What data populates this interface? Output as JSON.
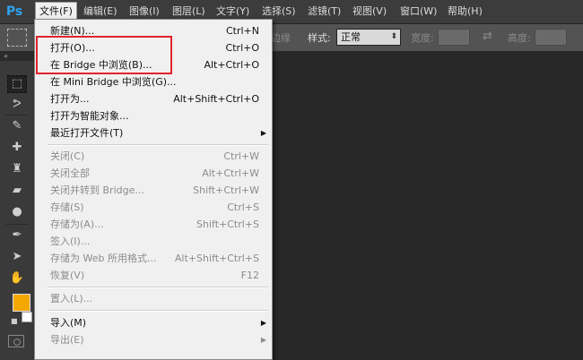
{
  "app": {
    "logo": "Ps"
  },
  "menubar": {
    "items": [
      {
        "label": "文件(F)"
      },
      {
        "label": "编辑(E)"
      },
      {
        "label": "图像(I)"
      },
      {
        "label": "图层(L)"
      },
      {
        "label": "文字(Y)"
      },
      {
        "label": "选择(S)"
      },
      {
        "label": "滤镜(T)"
      },
      {
        "label": "视图(V)"
      },
      {
        "label": "窗口(W)"
      },
      {
        "label": "帮助(H)"
      }
    ]
  },
  "options_bar": {
    "partial_label": "调整边缘...",
    "style_label": "样式:",
    "style_value": "正常",
    "width_label": "宽度:",
    "height_label": "高度:"
  },
  "file_menu": {
    "items": [
      {
        "label": "新建(N)...",
        "shortcut": "Ctrl+N",
        "enabled": true
      },
      {
        "label": "打开(O)...",
        "shortcut": "Ctrl+O",
        "enabled": true
      },
      {
        "label": "在 Bridge 中浏览(B)...",
        "shortcut": "Alt+Ctrl+O",
        "enabled": true
      },
      {
        "label": "在 Mini Bridge 中浏览(G)...",
        "shortcut": "",
        "enabled": true
      },
      {
        "label": "打开为...",
        "shortcut": "Alt+Shift+Ctrl+O",
        "enabled": true
      },
      {
        "label": "打开为智能对象...",
        "shortcut": "",
        "enabled": true
      },
      {
        "label": "最近打开文件(T)",
        "shortcut": "",
        "enabled": true,
        "submenu": true
      },
      {
        "label": "关闭(C)",
        "shortcut": "Ctrl+W",
        "enabled": false
      },
      {
        "label": "关闭全部",
        "shortcut": "Alt+Ctrl+W",
        "enabled": false
      },
      {
        "label": "关闭并转到 Bridge...",
        "shortcut": "Shift+Ctrl+W",
        "enabled": false
      },
      {
        "label": "存储(S)",
        "shortcut": "Ctrl+S",
        "enabled": false
      },
      {
        "label": "存储为(A)...",
        "shortcut": "Shift+Ctrl+S",
        "enabled": false
      },
      {
        "label": "签入(I)...",
        "shortcut": "",
        "enabled": false
      },
      {
        "label": "存储为 Web 所用格式...",
        "shortcut": "Alt+Shift+Ctrl+S",
        "enabled": false
      },
      {
        "label": "恢复(V)",
        "shortcut": "F12",
        "enabled": false
      },
      {
        "label": "置入(L)...",
        "shortcut": "",
        "enabled": false
      },
      {
        "label": "导入(M)",
        "shortcut": "",
        "enabled": true,
        "submenu": true
      },
      {
        "label": "导出(E)",
        "shortcut": "",
        "enabled": false,
        "submenu": true
      }
    ]
  },
  "colors": {
    "foreground": "#f4a700",
    "background": "#ffffff",
    "highlight_box": "#e0242b"
  }
}
